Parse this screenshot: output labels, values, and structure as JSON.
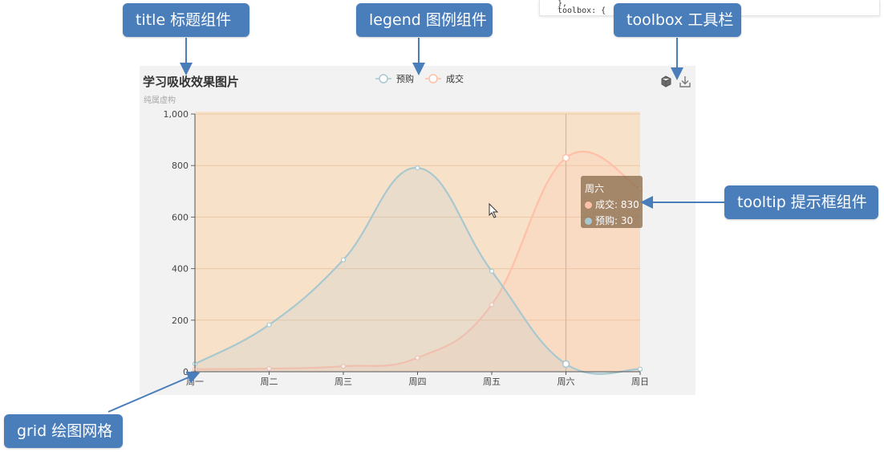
{
  "code_snippet": {
    "lines": [
      "},",
      "toolbox: {"
    ]
  },
  "callouts": {
    "title": "title 标题组件",
    "legend": "legend 图例组件",
    "toolbox": "toolbox 工具栏",
    "tooltip": "tooltip 提示框组件",
    "grid": "grid 绘图网格"
  },
  "chart_data": {
    "type": "line",
    "title": "学习吸收效果图片",
    "subtitle": "纯属虚构",
    "categories": [
      "周一",
      "周二",
      "周三",
      "周四",
      "周五",
      "周六",
      "周日"
    ],
    "ylim": [
      0,
      1000
    ],
    "yticks": [
      0,
      200,
      400,
      600,
      800,
      1000
    ],
    "ytick_labels": [
      "0",
      "200",
      "400",
      "600",
      "800",
      "1,000"
    ],
    "smooth": true,
    "area_fill": true,
    "legend_position": "top-center",
    "series": [
      {
        "name": "预购",
        "values": [
          30,
          182,
          434,
          791,
          390,
          30,
          10
        ],
        "color": "#a8c8d0"
      },
      {
        "name": "成交",
        "values": [
          10,
          12,
          21,
          54,
          260,
          830,
          710
        ],
        "color": "#ffbfa8"
      }
    ],
    "tooltip": {
      "category": "周六",
      "rows": [
        {
          "name": "成交",
          "value": "830",
          "color": "#ffbfa8"
        },
        {
          "name": "预购",
          "value": "30",
          "color": "#a8c8d0"
        }
      ]
    },
    "colors": {
      "grid_bg": "#f8e1c9",
      "panel_bg": "#f2f2f2"
    }
  }
}
